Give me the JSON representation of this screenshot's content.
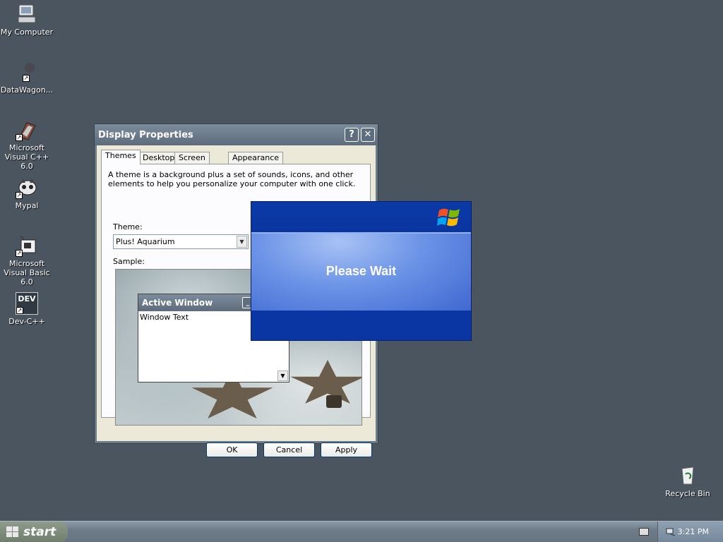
{
  "desktop": {
    "icons": [
      {
        "label": "My Computer",
        "icon": "computer-icon"
      },
      {
        "label": "DataWagon...",
        "icon": "datawagon-icon"
      },
      {
        "label": "Microsoft Visual C++ 6.0",
        "icon": "visual-cpp-icon"
      },
      {
        "label": "Mypal",
        "icon": "mypal-icon"
      },
      {
        "label": "Microsoft Visual Basic 6.0",
        "icon": "visual-basic-icon"
      },
      {
        "label": "Dev-C++",
        "icon": "devcpp-icon"
      },
      {
        "label": "Recycle Bin",
        "icon": "recycle-bin-icon"
      }
    ],
    "devcpp_badge": "DEV"
  },
  "dialog": {
    "title": "Display Properties",
    "help_button": "?",
    "close_button": "✕",
    "tabs": [
      "Themes",
      "Desktop",
      "Screen Saver",
      "Appearance"
    ],
    "active_tab": "Themes",
    "description": "A theme is a background plus a set of sounds, icons, and other elements to help you personalize your computer with one click.",
    "theme_label": "Theme:",
    "theme_value": "Plus! Aquarium",
    "sample_label": "Sample:",
    "sample_window": {
      "title": "Active Window",
      "text": "Window Text",
      "min_button": "_"
    },
    "buttons": {
      "ok": "OK",
      "cancel": "Cancel",
      "apply": "Apply"
    }
  },
  "splash": {
    "message": "Please Wait",
    "logo": "windows-flag-icon"
  },
  "taskbar": {
    "start_label": "start",
    "clock": "3:21 PM"
  },
  "colors": {
    "desktop": "#4a5560",
    "splash_blue": "#0032a0",
    "titlebar": "#6b7a88"
  }
}
